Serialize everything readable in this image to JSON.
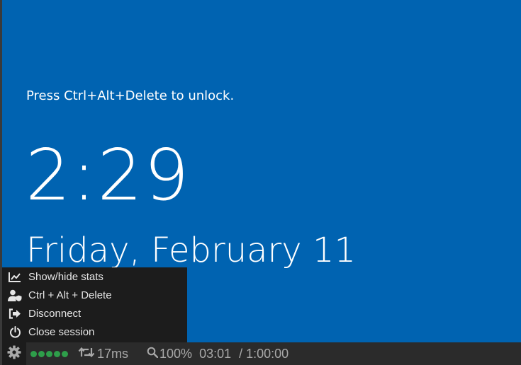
{
  "lock_screen": {
    "hint": "Press Ctrl+Alt+Delete to unlock.",
    "time": "2:29",
    "date": "Friday, February 11"
  },
  "menu": {
    "items": [
      {
        "label": "Show/hide stats",
        "icon": "chart-line-icon"
      },
      {
        "label": "Ctrl + Alt + Delete",
        "icon": "user-shield-icon"
      },
      {
        "label": "Disconnect",
        "icon": "sign-out-icon"
      },
      {
        "label": "Close session",
        "icon": "power-icon"
      }
    ]
  },
  "status": {
    "signal_level": 5,
    "signal_max": 5,
    "latency": "17ms",
    "zoom": "100%",
    "elapsed": "03:01",
    "duration": "/ 1:00:00"
  },
  "colors": {
    "lock_background": "#0063b1",
    "menu_background": "#1c1c1c",
    "status_background": "#2b2b2b",
    "status_text": "#a9a9a9",
    "signal_on": "#2e9e4a"
  }
}
